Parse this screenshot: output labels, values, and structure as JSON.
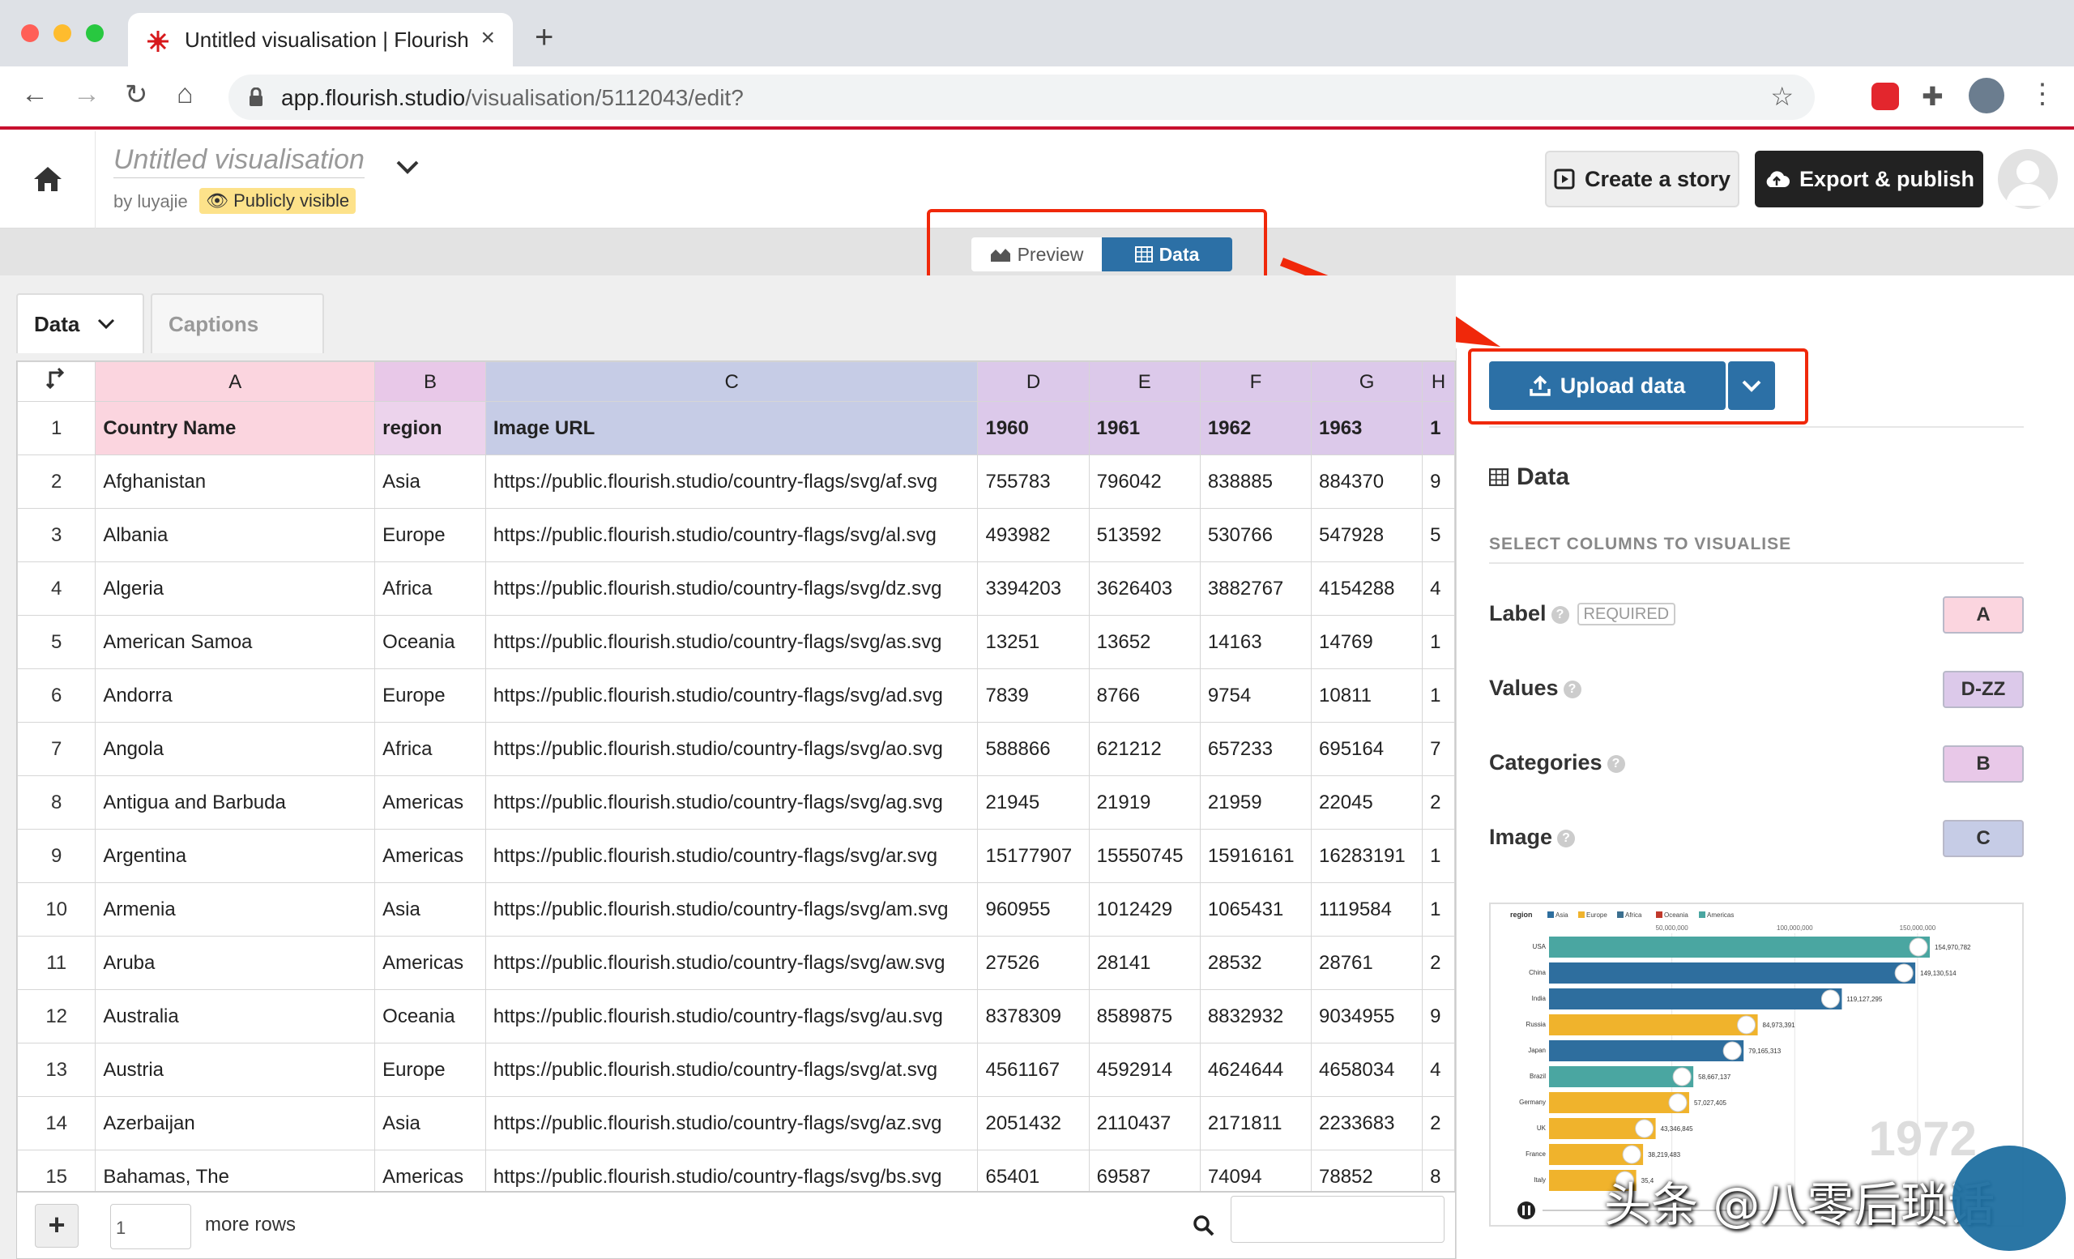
{
  "browser": {
    "tab_title": "Untitled visualisation | Flourish",
    "url_host": "app.flourish.studio",
    "url_path": "/visualisation/5112043/edit?"
  },
  "header": {
    "title": "Untitled visualisation",
    "byline": "by luyajie",
    "visibility": "Publicly visible",
    "create_story": "Create a story",
    "export_publish": "Export & publish"
  },
  "view_toggle": {
    "preview": "Preview",
    "data": "Data"
  },
  "sheet_tabs": {
    "data": "Data",
    "captions": "Captions"
  },
  "grid": {
    "columns": [
      "A",
      "B",
      "C",
      "D",
      "E",
      "F",
      "G",
      "H"
    ],
    "rows": [
      [
        "1",
        "Country Name",
        "region",
        "Image URL",
        "1960",
        "1961",
        "1962",
        "1963",
        "1"
      ],
      [
        "2",
        "Afghanistan",
        "Asia",
        "https://public.flourish.studio/country-flags/svg/af.svg",
        "755783",
        "796042",
        "838885",
        "884370",
        "9"
      ],
      [
        "3",
        "Albania",
        "Europe",
        "https://public.flourish.studio/country-flags/svg/al.svg",
        "493982",
        "513592",
        "530766",
        "547928",
        "5"
      ],
      [
        "4",
        "Algeria",
        "Africa",
        "https://public.flourish.studio/country-flags/svg/dz.svg",
        "3394203",
        "3626403",
        "3882767",
        "4154288",
        "4"
      ],
      [
        "5",
        "American Samoa",
        "Oceania",
        "https://public.flourish.studio/country-flags/svg/as.svg",
        "13251",
        "13652",
        "14163",
        "14769",
        "1"
      ],
      [
        "6",
        "Andorra",
        "Europe",
        "https://public.flourish.studio/country-flags/svg/ad.svg",
        "7839",
        "8766",
        "9754",
        "10811",
        "1"
      ],
      [
        "7",
        "Angola",
        "Africa",
        "https://public.flourish.studio/country-flags/svg/ao.svg",
        "588866",
        "621212",
        "657233",
        "695164",
        "7"
      ],
      [
        "8",
        "Antigua and Barbuda",
        "Americas",
        "https://public.flourish.studio/country-flags/svg/ag.svg",
        "21945",
        "21919",
        "21959",
        "22045",
        "2"
      ],
      [
        "9",
        "Argentina",
        "Americas",
        "https://public.flourish.studio/country-flags/svg/ar.svg",
        "15177907",
        "15550745",
        "15916161",
        "16283191",
        "1"
      ],
      [
        "10",
        "Armenia",
        "Asia",
        "https://public.flourish.studio/country-flags/svg/am.svg",
        "960955",
        "1012429",
        "1065431",
        "1119584",
        "1"
      ],
      [
        "11",
        "Aruba",
        "Americas",
        "https://public.flourish.studio/country-flags/svg/aw.svg",
        "27526",
        "28141",
        "28532",
        "28761",
        "2"
      ],
      [
        "12",
        "Australia",
        "Oceania",
        "https://public.flourish.studio/country-flags/svg/au.svg",
        "8378309",
        "8589875",
        "8832932",
        "9034955",
        "9"
      ],
      [
        "13",
        "Austria",
        "Europe",
        "https://public.flourish.studio/country-flags/svg/at.svg",
        "4561167",
        "4592914",
        "4624644",
        "4658034",
        "4"
      ],
      [
        "14",
        "Azerbaijan",
        "Asia",
        "https://public.flourish.studio/country-flags/svg/az.svg",
        "2051432",
        "2110437",
        "2171811",
        "2233683",
        "2"
      ],
      [
        "15",
        "Bahamas, The",
        "Americas",
        "https://public.flourish.studio/country-flags/svg/bs.svg",
        "65401",
        "69587",
        "74094",
        "78852",
        "8"
      ]
    ],
    "wrapped_rows": [
      "10",
      "11"
    ],
    "add_rows_value": "1",
    "more_rows": "more rows"
  },
  "panel": {
    "upload": "Upload data",
    "data_heading": "Data",
    "select_columns": "SELECT COLUMNS TO VISUALISE",
    "required": "REQUIRED",
    "bindings": [
      {
        "label": "Label",
        "value": "A",
        "color": "#fbd5df"
      },
      {
        "label": "Values",
        "value": "D-ZZ",
        "color": "#dcc9ea"
      },
      {
        "label": "Categories",
        "value": "B",
        "color": "#e8c8e8"
      },
      {
        "label": "Image",
        "value": "C",
        "color": "#c6cce6"
      }
    ]
  },
  "thumbnail": {
    "legend_title": "region",
    "legend": [
      {
        "name": "Asia",
        "color": "#2e6e9e"
      },
      {
        "name": "Europe",
        "color": "#f0b32c"
      },
      {
        "name": "Africa",
        "color": "#3c6f8f"
      },
      {
        "name": "Oceania",
        "color": "#c0392b"
      },
      {
        "name": "Americas",
        "color": "#4aa6a1"
      }
    ],
    "axis_ticks": [
      "50,000,000",
      "100,000,000",
      "150,000,000"
    ],
    "year": "1972",
    "bars": [
      {
        "label": "USA",
        "value": "154,970,782",
        "v": 1.0,
        "color": "#4aa6a1"
      },
      {
        "label": "China",
        "value": "149,130,514",
        "v": 0.962,
        "color": "#2e6e9e"
      },
      {
        "label": "India",
        "value": "119,127,295",
        "v": 0.769,
        "color": "#2e6e9e"
      },
      {
        "label": "Russia",
        "value": "84,973,391",
        "v": 0.548,
        "color": "#f0b32c"
      },
      {
        "label": "Japan",
        "value": "79,165,313",
        "v": 0.511,
        "color": "#2e6e9e"
      },
      {
        "label": "Brazil",
        "value": "58,667,137",
        "v": 0.379,
        "color": "#4aa6a1"
      },
      {
        "label": "Germany",
        "value": "57,027,405",
        "v": 0.368,
        "color": "#f0b32c"
      },
      {
        "label": "UK",
        "value": "43,346,845",
        "v": 0.28,
        "color": "#f0b32c"
      },
      {
        "label": "France",
        "value": "38,219,483",
        "v": 0.247,
        "color": "#f0b32c"
      },
      {
        "label": "Italy",
        "value": "35,4",
        "v": 0.229,
        "color": "#f0b32c"
      }
    ]
  },
  "watermark": "头条 @八零后琐话"
}
